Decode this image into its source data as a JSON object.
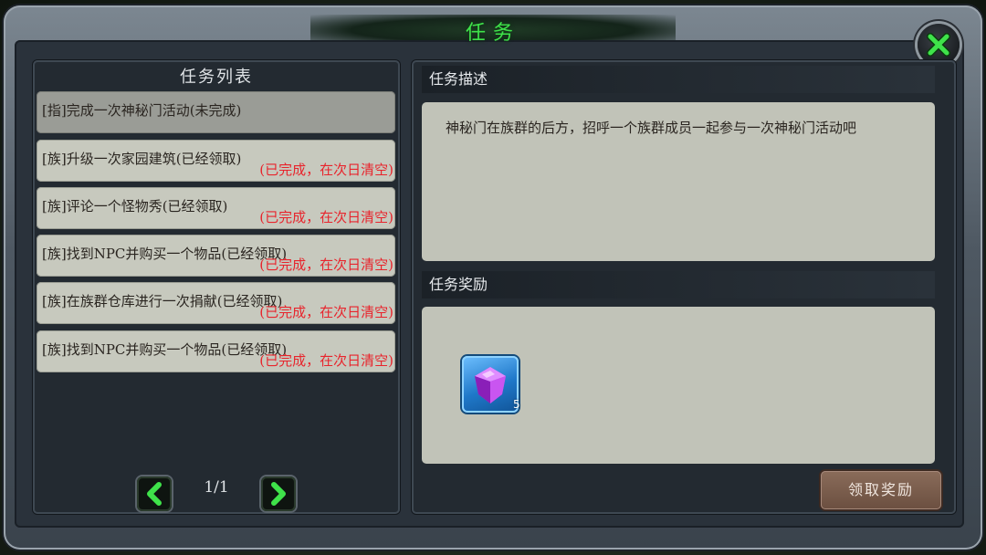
{
  "window": {
    "title": "任务"
  },
  "quest_list": {
    "header": "任务列表",
    "rows": [
      {
        "text": "[指]完成一次神秘门活动(未完成)",
        "status": ""
      },
      {
        "text": "[族]升级一次家园建筑(已经领取)",
        "status": "(已完成，在次日清空)"
      },
      {
        "text": "[族]评论一个怪物秀(已经领取)",
        "status": "(已完成，在次日清空)"
      },
      {
        "text": "[族]找到NPC并购买一个物品(已经领取)",
        "status": "(已完成，在次日清空)"
      },
      {
        "text": "[族]在族群仓库进行一次捐献(已经领取)",
        "status": "(已完成，在次日清空)"
      },
      {
        "text": "[族]找到NPC并购买一个物品(已经领取)",
        "status": "(已完成，在次日清空)"
      }
    ],
    "selected_index": 0,
    "pagination": "1/1",
    "prev_icon": "chevron-left-icon",
    "next_icon": "chevron-right-icon"
  },
  "description": {
    "header": "任务描述",
    "text": "神秘门在族群的后方，招呼一个族群成员一起参与一次神秘门活动吧"
  },
  "reward": {
    "header": "任务奖励",
    "item_icon": "purple-gem-icon",
    "item_count": "5",
    "claim_label": "领取奖励"
  },
  "colors": {
    "title": "#3fe24a",
    "status_text": "#e8242c",
    "row_bg": "#c7c9be",
    "selected_row_bg": "#9a9c96",
    "claim_button": "#7a5e4e"
  }
}
